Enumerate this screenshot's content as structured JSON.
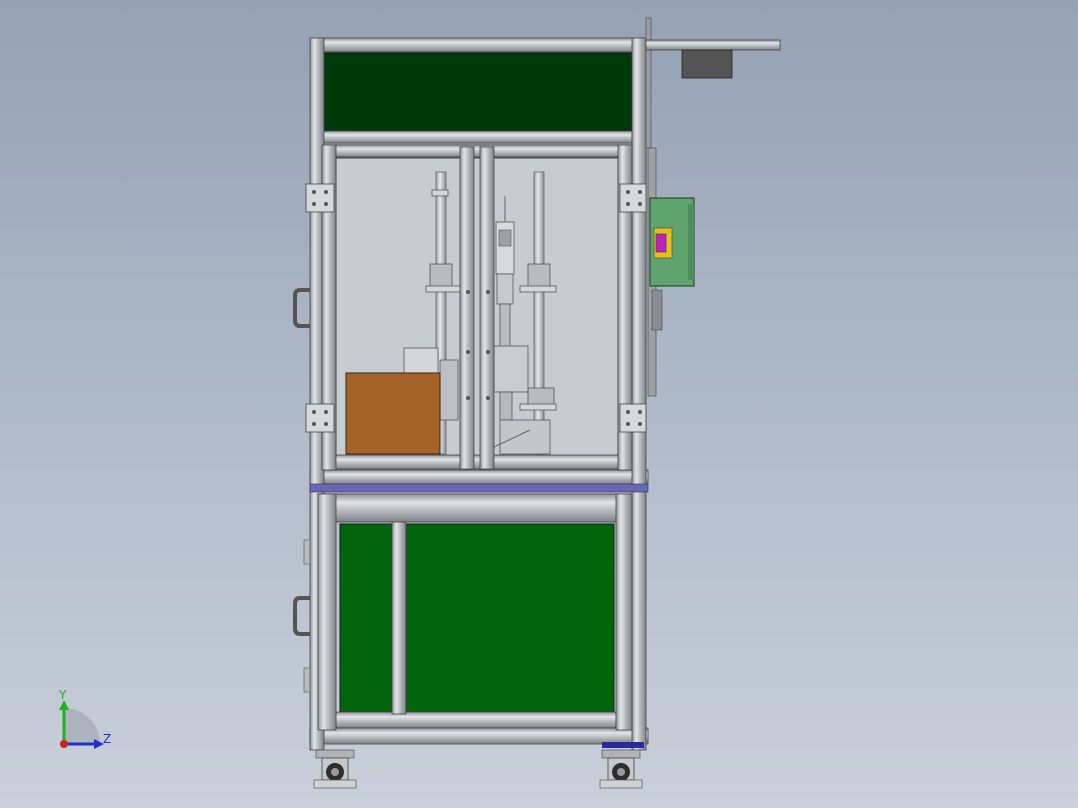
{
  "viewport": {
    "background_top": "#94a2b4",
    "background_bottom": "#c9d0da"
  },
  "model": {
    "upper_panel_color": "#003a0a",
    "lower_panel_color": "#04640c",
    "frame_color": "#c4c8cc",
    "accent_stripe_color": "#6868b0",
    "box_color": "#a5632a",
    "control_box_color": "#5fa46c",
    "connector_color": "#c020c0",
    "motor_color": "#545454"
  },
  "triad": {
    "y_label": "Y",
    "z_label": "Z",
    "y_color": "#20b020",
    "z_color": "#2030d0",
    "x_color": "#d02020"
  }
}
